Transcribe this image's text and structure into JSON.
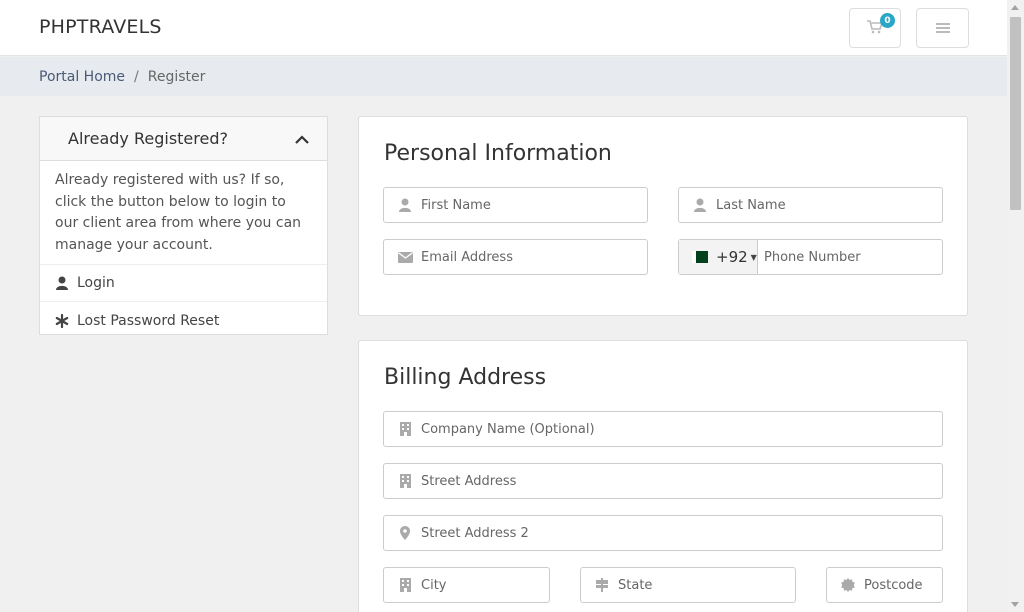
{
  "header": {
    "logo": "PHPTRAVELS",
    "cart_count": "0",
    "cart_icon": "cart-icon",
    "menu_icon": "hamburger-icon"
  },
  "breadcrumb": {
    "home": "Portal Home",
    "separator": "/",
    "current": "Register"
  },
  "sidebar": {
    "title": "Already Registered?",
    "description": "Already registered with us? If so, click the button below to login to our client area from where you can manage your account.",
    "items": [
      {
        "label": "Login",
        "icon": "user-icon"
      },
      {
        "label": "Lost Password Reset",
        "icon": "asterisk-icon"
      }
    ]
  },
  "personal": {
    "title": "Personal Information",
    "first_name": "First Name",
    "last_name": "Last Name",
    "email": "Email Address",
    "country_code": "+92",
    "phone": "Phone Number"
  },
  "billing": {
    "title": "Billing Address",
    "company": "Company Name (Optional)",
    "street": "Street Address",
    "street2": "Street Address 2",
    "city": "City",
    "state": "State",
    "postcode": "Postcode"
  },
  "colors": {
    "badge": "#2aa7c4",
    "breadcrumb_bg": "#e7ebef",
    "page_bg": "#f0f0f0"
  }
}
